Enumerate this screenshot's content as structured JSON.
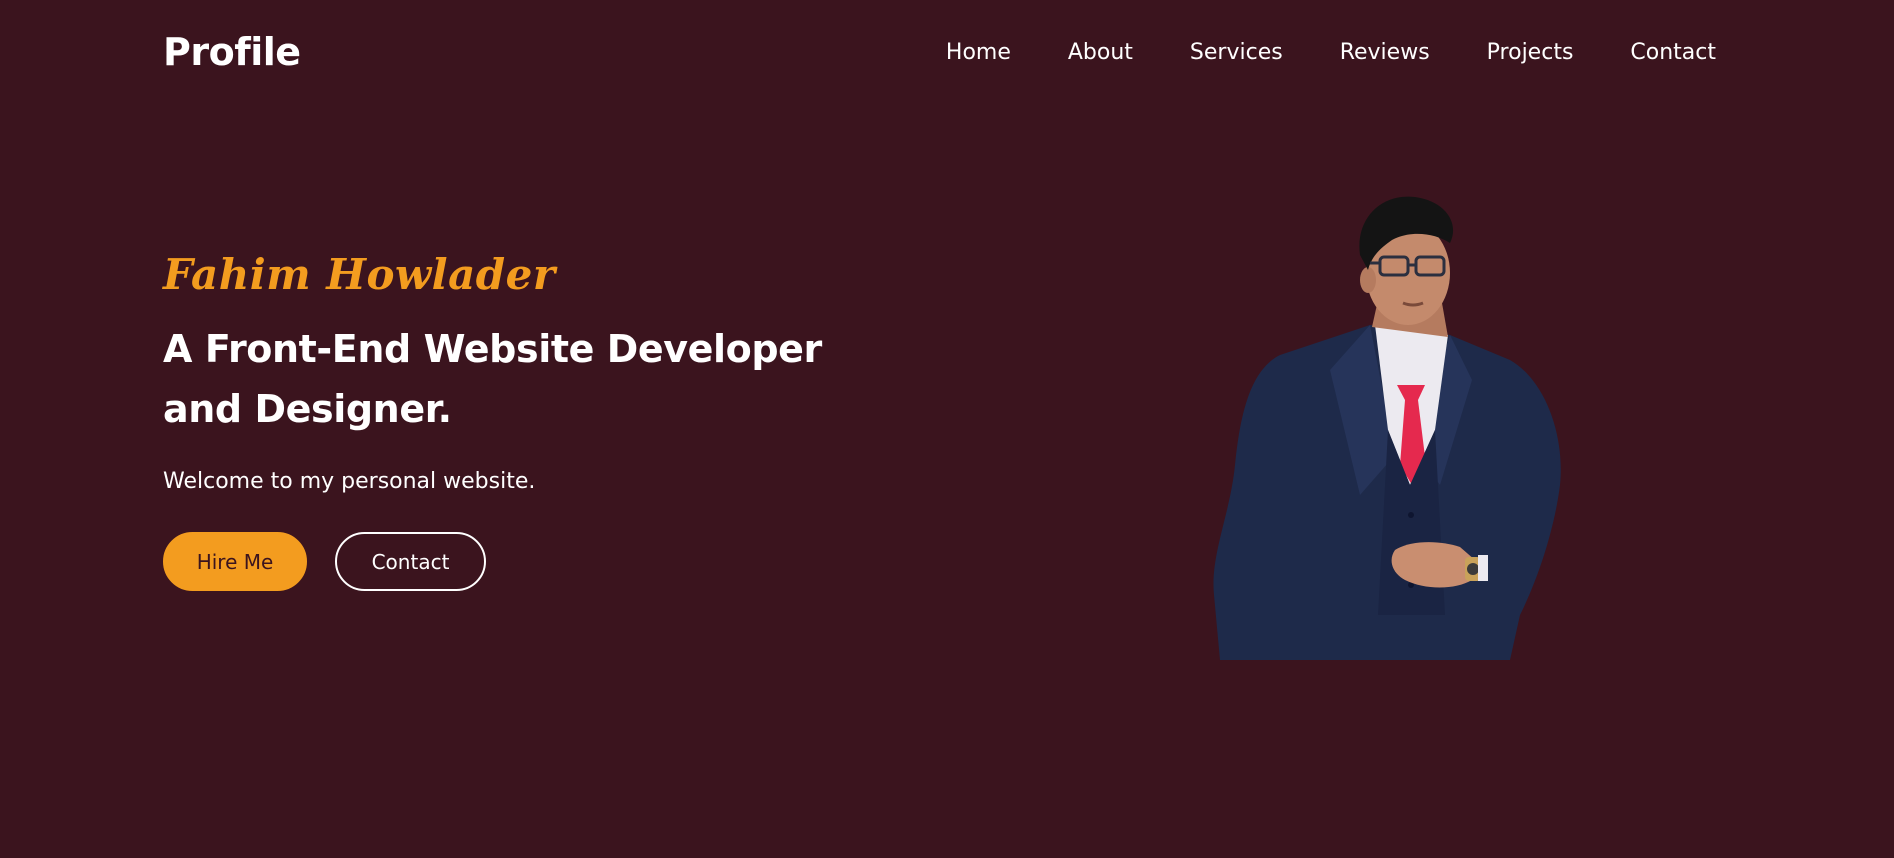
{
  "header": {
    "logo": "Profile",
    "nav": [
      {
        "label": "Home"
      },
      {
        "label": "About"
      },
      {
        "label": "Services"
      },
      {
        "label": "Reviews"
      },
      {
        "label": "Projects"
      },
      {
        "label": "Contact"
      }
    ]
  },
  "hero": {
    "name": "Fahim Howlader",
    "title": "A Front-End Website Developer and Designer.",
    "subtitle": "Welcome to my personal website.",
    "buttons": {
      "primary": "Hire Me",
      "secondary": "Contact"
    },
    "image": "profile-photo-man-in-navy-suit"
  },
  "colors": {
    "background": "#3b141e",
    "accent": "#f39c1f",
    "text": "#ffffff"
  }
}
